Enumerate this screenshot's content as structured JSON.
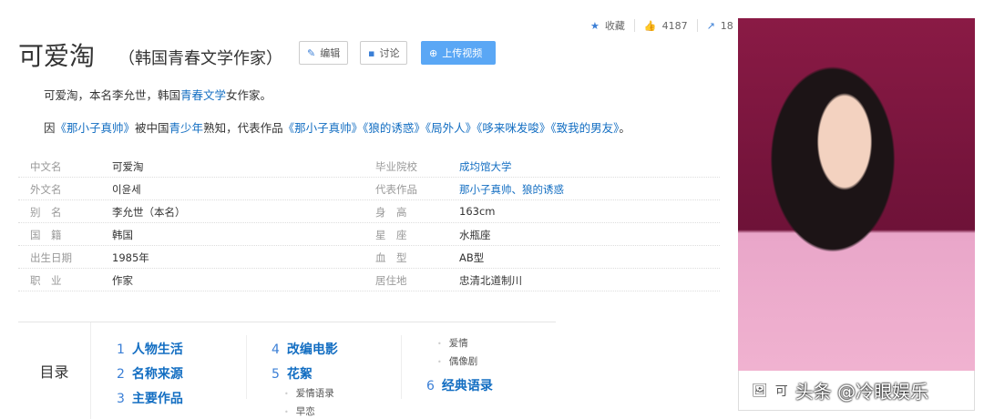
{
  "topbar": {
    "favorite": "收藏",
    "likes": "4187",
    "shares": "18"
  },
  "title": "可爱淘",
  "subtitle": "（韩国青春文学作家）",
  "buttons": {
    "edit": "编辑",
    "discuss": "讨论",
    "upload": "上传视频"
  },
  "intro": {
    "p1a": "可爱淘，本名李允世，韩国",
    "p1link": "青春文学",
    "p1b": "女作家。",
    "p2a": "因",
    "p2l1": "《那小子真帅》",
    "p2b": "被中国",
    "p2l2": "青少年",
    "p2c": "熟知，代表作品",
    "p2l3": "《那小子真帅》",
    "p2l4": "《狼的诱惑》",
    "p2l5": "《局外人》",
    "p2l6": "《哆来咪发唆》",
    "p2l7": "《致我的男友》",
    "p2d": "。"
  },
  "info": [
    {
      "l1": "中文名",
      "v1": "可爱淘",
      "l2": "毕业院校",
      "v2": "成均馆大学"
    },
    {
      "l1": "外文名",
      "v1": "이윤세",
      "l2": "代表作品",
      "v2": "那小子真帅、狼的诱惑"
    },
    {
      "l1": "别　名",
      "v1": "李允世（本名）",
      "l2": "身　高",
      "v2": "163cm"
    },
    {
      "l1": "国　籍",
      "v1": "韩国",
      "l2": "星　座",
      "v2": "水瓶座"
    },
    {
      "l1": "出生日期",
      "v1": "1985年",
      "l2": "血　型",
      "v2": "AB型"
    },
    {
      "l1": "职　业",
      "v1": "作家",
      "l2": "居住地",
      "v2": "忠清北道制川"
    }
  ],
  "toc": {
    "heading": "目录",
    "items": [
      {
        "n": "1",
        "t": "人物生活"
      },
      {
        "n": "2",
        "t": "名称来源"
      },
      {
        "n": "3",
        "t": "主要作品"
      },
      {
        "n": "4",
        "t": "改编电影"
      },
      {
        "n": "5",
        "t": "花絮"
      },
      {
        "n": "6",
        "t": "经典语录"
      }
    ],
    "subs": [
      "爱情语录",
      "早恋",
      "爱情",
      "偶像剧"
    ]
  },
  "photo": {
    "caption": "可",
    "watermark": "头条 @冷眼娱乐"
  }
}
